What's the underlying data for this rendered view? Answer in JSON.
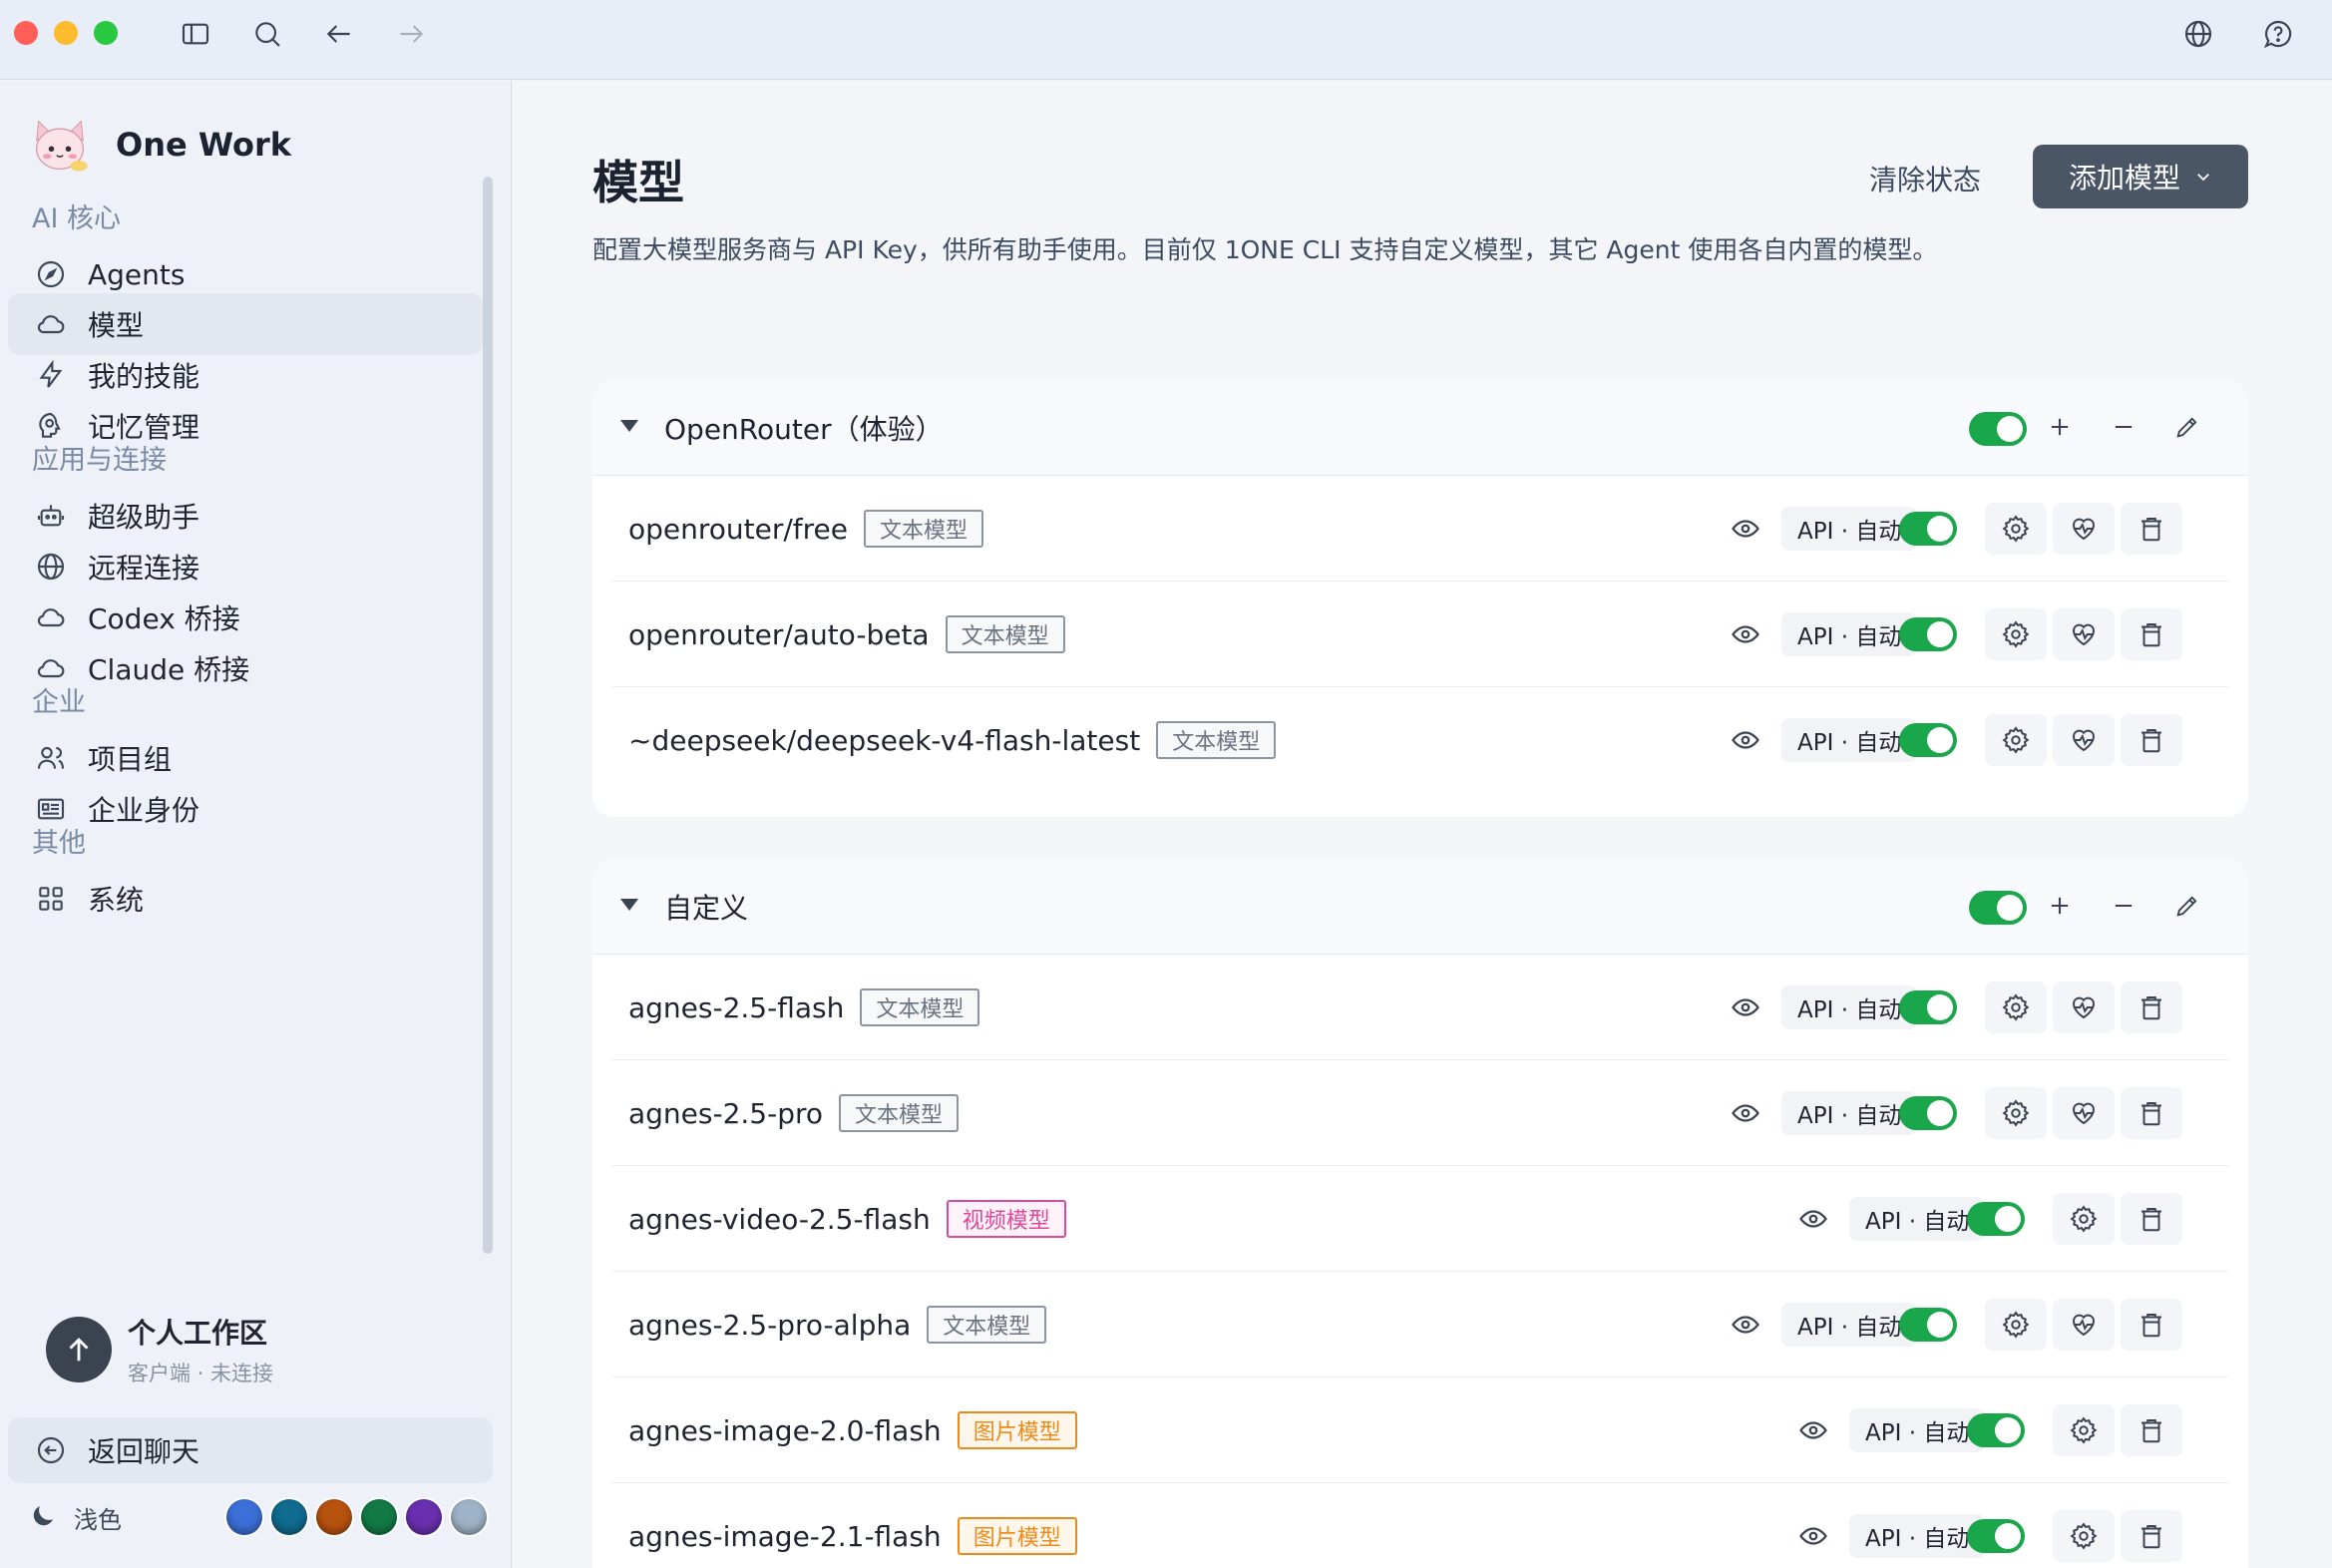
{
  "window": {
    "toolbar": {
      "sidebar_toggle": "sidebar-icon",
      "search": "search-icon",
      "back": "arrow-left-icon",
      "forward": "arrow-right-icon",
      "language": "globe-icon",
      "help": "help-icon"
    }
  },
  "sidebar": {
    "brand": "One Work",
    "sections": [
      {
        "label": "AI 核心",
        "items": [
          {
            "label": "Agents",
            "icon": "compass-icon"
          },
          {
            "label": "模型",
            "icon": "cloud-icon",
            "active": true
          },
          {
            "label": "我的技能",
            "icon": "bolt-icon"
          },
          {
            "label": "记忆管理",
            "icon": "brain-icon"
          }
        ]
      },
      {
        "label": "应用与连接",
        "items": [
          {
            "label": "超级助手",
            "icon": "robot-icon"
          },
          {
            "label": "远程连接",
            "icon": "globe-icon"
          },
          {
            "label": "Codex 桥接",
            "icon": "cloud-icon"
          },
          {
            "label": "Claude 桥接",
            "icon": "cloud-icon"
          }
        ]
      },
      {
        "label": "企业",
        "items": [
          {
            "label": "项目组",
            "icon": "users-icon"
          },
          {
            "label": "企业身份",
            "icon": "id-card-icon"
          }
        ]
      },
      {
        "label": "其他",
        "items": [
          {
            "label": "系统",
            "icon": "grid-icon"
          }
        ]
      }
    ],
    "workspace": {
      "title": "个人工作区",
      "subtitle": "客户端 · 未连接"
    },
    "back_chat": "返回聊天",
    "theme": {
      "label": "浅色",
      "swatches": [
        "#3c6fd8",
        "#0f6b8f",
        "#b8520f",
        "#137a46",
        "#6a2fb0",
        "#9fb3c8"
      ]
    }
  },
  "main": {
    "title": "模型",
    "clear_label": "清除状态",
    "add_label": "添加模型",
    "description": "配置大模型服务商与 API Key，供所有助手使用。目前仅 1ONE CLI 支持自定义模型，其它 Agent 使用各自内置的模型。",
    "groups": [
      {
        "name": "OpenRouter（体验）",
        "enabled": true,
        "models": [
          {
            "name": "openrouter/free",
            "tag": "文本模型",
            "tag_type": "text",
            "mode": "API · 自动",
            "enabled": true,
            "health": true
          },
          {
            "name": "openrouter/auto-beta",
            "tag": "文本模型",
            "tag_type": "text",
            "mode": "API · 自动",
            "enabled": true,
            "health": true
          },
          {
            "name": "~deepseek/deepseek-v4-flash-latest",
            "tag": "文本模型",
            "tag_type": "text",
            "mode": "API · 自动",
            "enabled": true,
            "health": true
          }
        ]
      },
      {
        "name": "自定义",
        "enabled": true,
        "models": [
          {
            "name": "agnes-2.5-flash",
            "tag": "文本模型",
            "tag_type": "text",
            "mode": "API · 自动",
            "enabled": true,
            "health": true
          },
          {
            "name": "agnes-2.5-pro",
            "tag": "文本模型",
            "tag_type": "text",
            "mode": "API · 自动",
            "enabled": true,
            "health": true
          },
          {
            "name": "agnes-video-2.5-flash",
            "tag": "视频模型",
            "tag_type": "video",
            "mode": "API · 自动",
            "enabled": true,
            "health": false
          },
          {
            "name": "agnes-2.5-pro-alpha",
            "tag": "文本模型",
            "tag_type": "text",
            "mode": "API · 自动",
            "enabled": true,
            "health": true
          },
          {
            "name": "agnes-image-2.0-flash",
            "tag": "图片模型",
            "tag_type": "image",
            "mode": "API · 自动",
            "enabled": true,
            "health": false
          },
          {
            "name": "agnes-image-2.1-flash",
            "tag": "图片模型",
            "tag_type": "image",
            "mode": "API · 自动",
            "enabled": true,
            "health": false
          }
        ]
      }
    ]
  }
}
